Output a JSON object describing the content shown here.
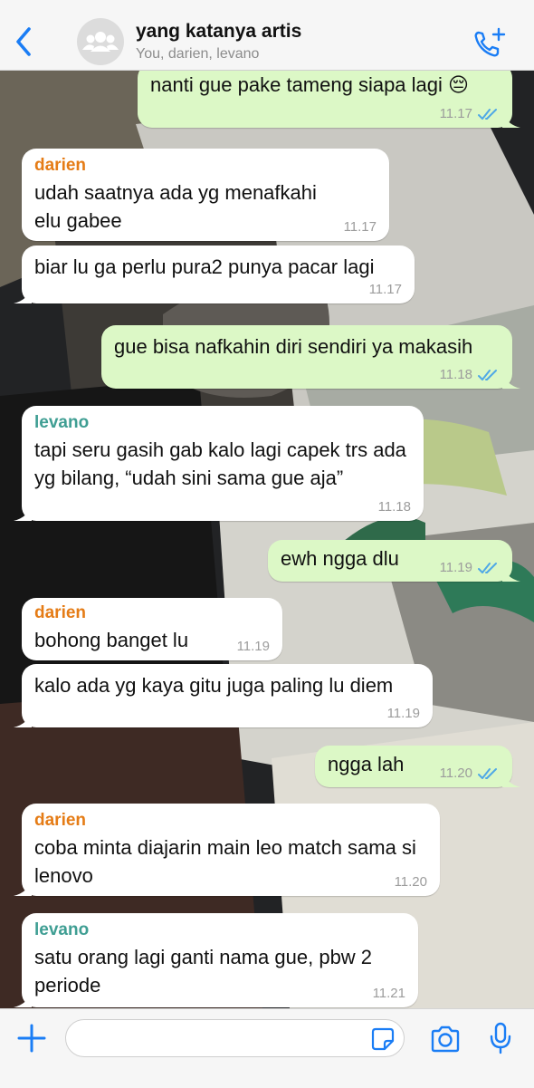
{
  "header": {
    "title": "yang katanya artis",
    "subtitle": "You, darien, levano"
  },
  "colors": {
    "accent": "#1a7df5",
    "darien": "#e57c16",
    "levano": "#3f9e93",
    "outgoing_bubble": "#dcf8c6",
    "read_ticks": "#4fa8e6"
  },
  "icons": {
    "back": "chevron-left",
    "avatar": "group-avatar",
    "call": "phone-plus",
    "plus": "plus",
    "sticker": "sticker",
    "camera": "camera",
    "mic": "microphone"
  },
  "messages": [
    {
      "direction": "out",
      "text": "nanti gue pake tameng siapa lagi 😔",
      "time": "11.17",
      "read": true
    },
    {
      "direction": "in",
      "sender": "darien",
      "text": "udah saatnya ada yg menafkahi elu gabee",
      "time": "11.17"
    },
    {
      "direction": "in",
      "text": "biar lu ga perlu pura2 punya pacar lagi",
      "time": "11.17"
    },
    {
      "direction": "out",
      "text": "gue bisa nafkahin diri sendiri ya makasih",
      "time": "11.18",
      "read": true
    },
    {
      "direction": "in",
      "sender": "levano",
      "text": "tapi seru gasih gab kalo lagi capek trs ada yg bilang, “udah sini sama gue aja”",
      "time": "11.18"
    },
    {
      "direction": "out",
      "text": "ewh ngga dlu",
      "time": "11.19",
      "read": true
    },
    {
      "direction": "in",
      "sender": "darien",
      "text": "bohong banget lu",
      "time": "11.19"
    },
    {
      "direction": "in",
      "text": "kalo ada yg kaya gitu juga paling lu diem",
      "time": "11.19"
    },
    {
      "direction": "out",
      "text": "ngga lah",
      "time": "11.20",
      "read": true
    },
    {
      "direction": "in",
      "sender": "darien",
      "text": "coba minta diajarin main leo match sama si lenovo",
      "time": "11.20"
    },
    {
      "direction": "in",
      "sender": "levano",
      "text": "satu orang lagi ganti nama gue, pbw 2 periode",
      "time": "11.21"
    }
  ],
  "input": {
    "value": "",
    "placeholder": ""
  }
}
